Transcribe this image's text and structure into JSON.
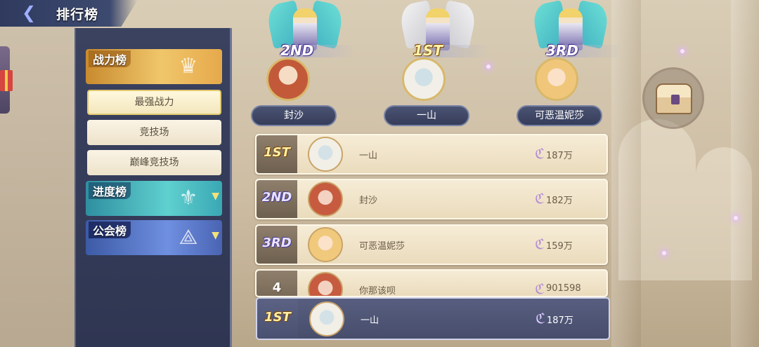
{
  "header": {
    "title": "排行榜",
    "back_icon": "back-arrow-icon"
  },
  "sidebar": {
    "categories": [
      {
        "label": "战力榜",
        "emblem": "power-emblem-icon",
        "color": "#e6a94b"
      },
      {
        "label": "进度榜",
        "emblem": "progress-emblem-icon",
        "color": "#5fd0cf"
      },
      {
        "label": "公会榜",
        "emblem": "guild-emblem-icon",
        "color": "#6f8fe0"
      }
    ],
    "sub_tabs": [
      {
        "label": "最强战力",
        "active": true
      },
      {
        "label": "竞技场",
        "active": false
      },
      {
        "label": "巅峰竞技场",
        "active": false
      }
    ]
  },
  "podium": [
    {
      "rank": "2ND",
      "name": "封沙"
    },
    {
      "rank": "1ST",
      "name": "一山"
    },
    {
      "rank": "3RD",
      "name": "可恶温妮莎"
    }
  ],
  "ranking": [
    {
      "rank": "1ST",
      "name": "一山",
      "power": "187万"
    },
    {
      "rank": "2ND",
      "name": "封沙",
      "power": "182万"
    },
    {
      "rank": "3RD",
      "name": "可恶温妮莎",
      "power": "159万"
    },
    {
      "rank": "4",
      "name": "你那该呗",
      "power": "901598"
    }
  ],
  "self": {
    "rank": "1ST",
    "name": "一山",
    "power": "187万"
  },
  "power_icon": "power-glyph-icon",
  "chest_icon": "treasure-chest-icon"
}
